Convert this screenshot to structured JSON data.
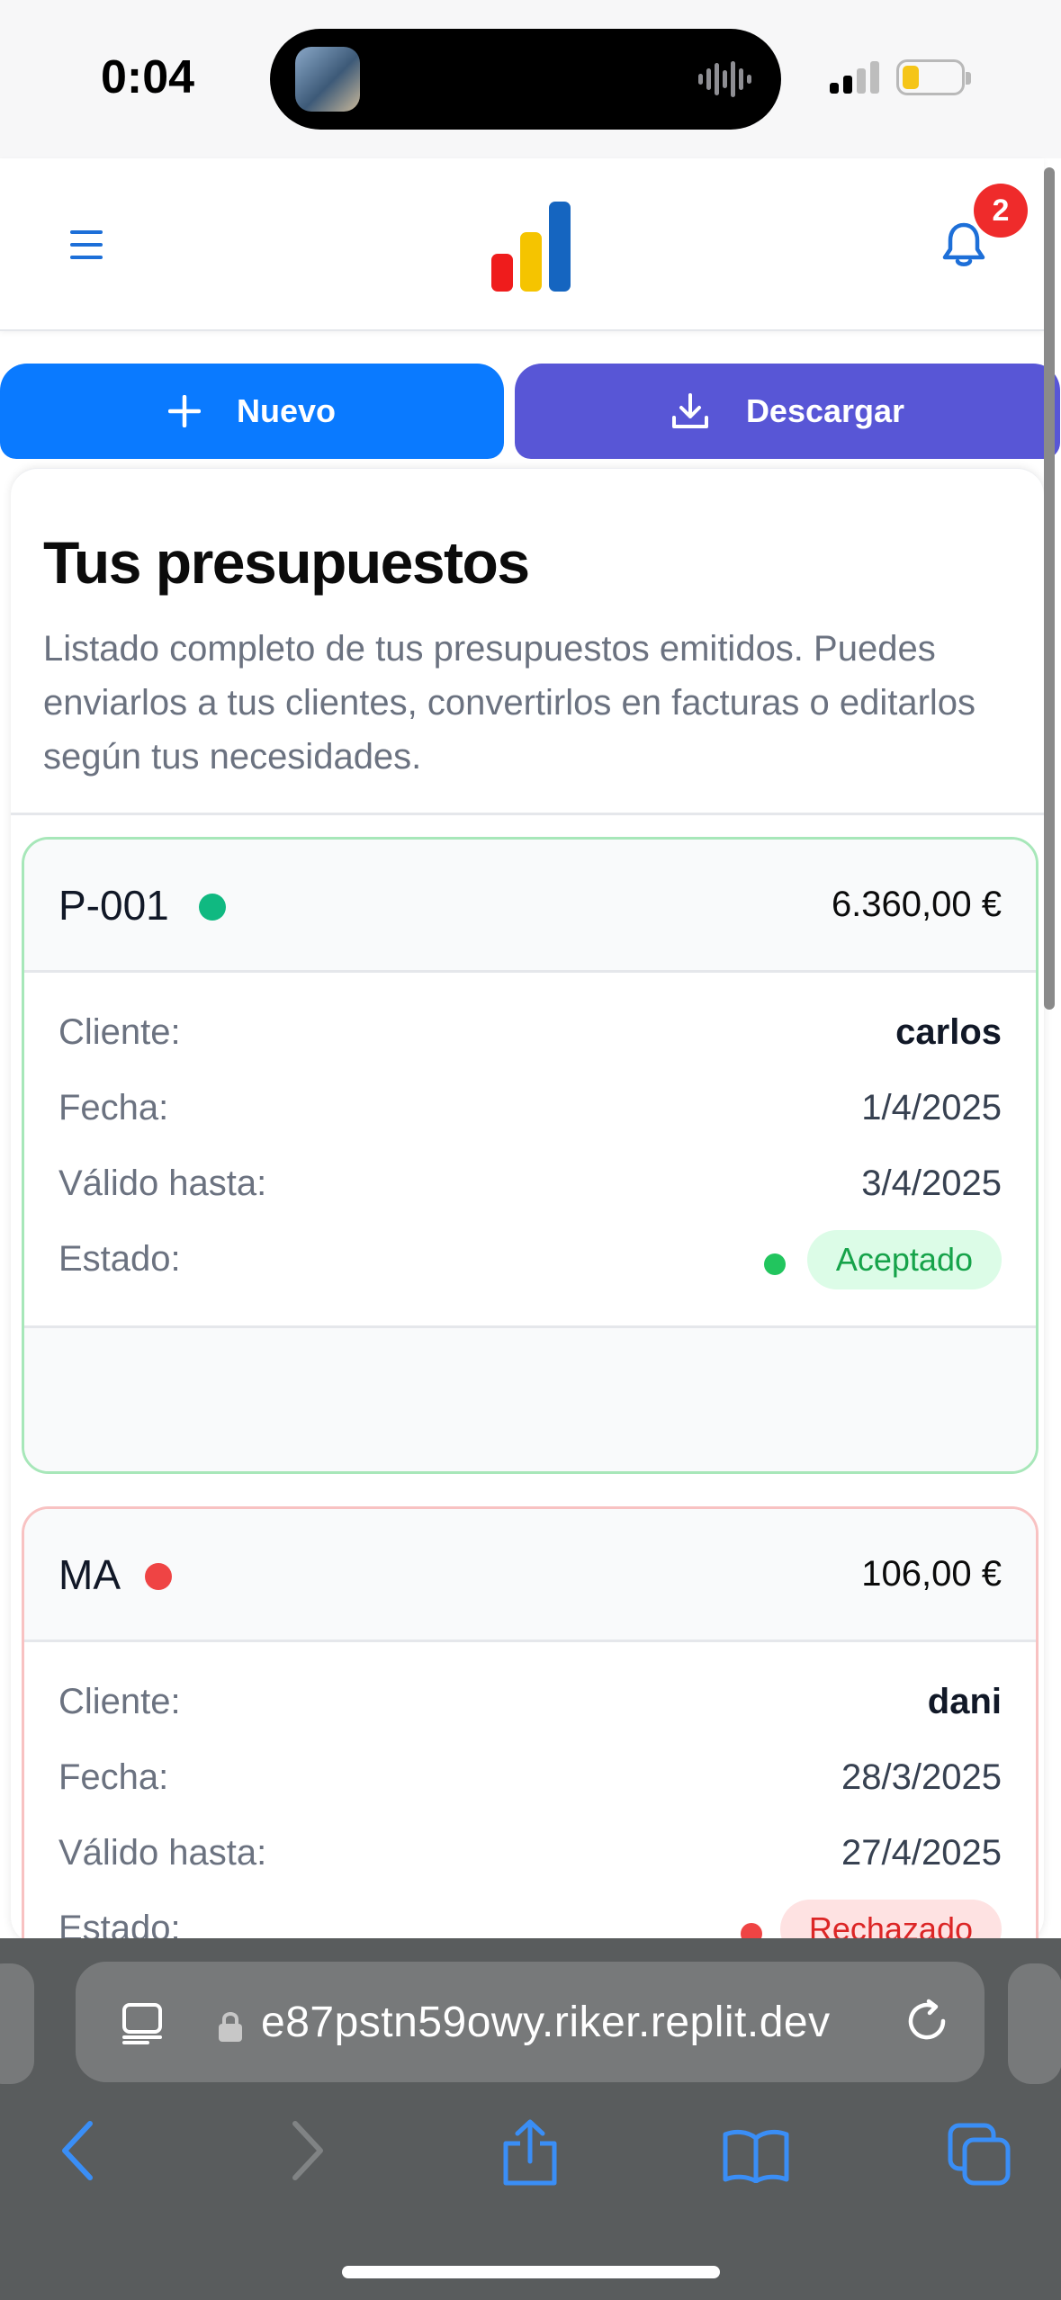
{
  "status_bar": {
    "time": "0:04"
  },
  "header": {
    "menu_icon": "hamburger-menu-icon",
    "logo_icon": "bar-chart-logo",
    "logo_colors": [
      "#ef1c1c",
      "#f5c400",
      "#1565c0"
    ],
    "bell_icon": "bell-icon",
    "notification_count": "2"
  },
  "actions": {
    "new_label": "Nuevo",
    "new_icon": "plus-icon",
    "download_label": "Descargar",
    "download_icon": "download-icon"
  },
  "page": {
    "title": "Tus presupuestos",
    "description": "Listado completo de tus presupuestos emitidos. Puedes enviarlos a tus clientes, convertirlos en facturas o editarlos según tus necesidades."
  },
  "labels": {
    "client": "Cliente:",
    "date": "Fecha:",
    "valid_until": "Válido hasta:",
    "status": "Estado:"
  },
  "quotes": [
    {
      "id": "P-001",
      "amount": "6.360,00 €",
      "client": "carlos",
      "date": "1/4/2025",
      "valid_until": "3/4/2025",
      "status": "Aceptado",
      "status_color": "#16a34a",
      "status_bg": "#dcfce7",
      "dot_color": "#10b981"
    },
    {
      "id": "MA",
      "amount": "106,00 €",
      "client": "dani",
      "date": "28/3/2025",
      "valid_until": "27/4/2025",
      "status": "Rechazado",
      "status_color": "#dc2626",
      "status_bg": "#fee2e2",
      "dot_color": "#ef4444"
    }
  ],
  "browser": {
    "url": "e87pstn59owy.riker.replit.dev",
    "nav_icons": [
      "back-icon",
      "forward-icon",
      "share-icon",
      "bookmarks-icon",
      "tabs-icon"
    ]
  }
}
